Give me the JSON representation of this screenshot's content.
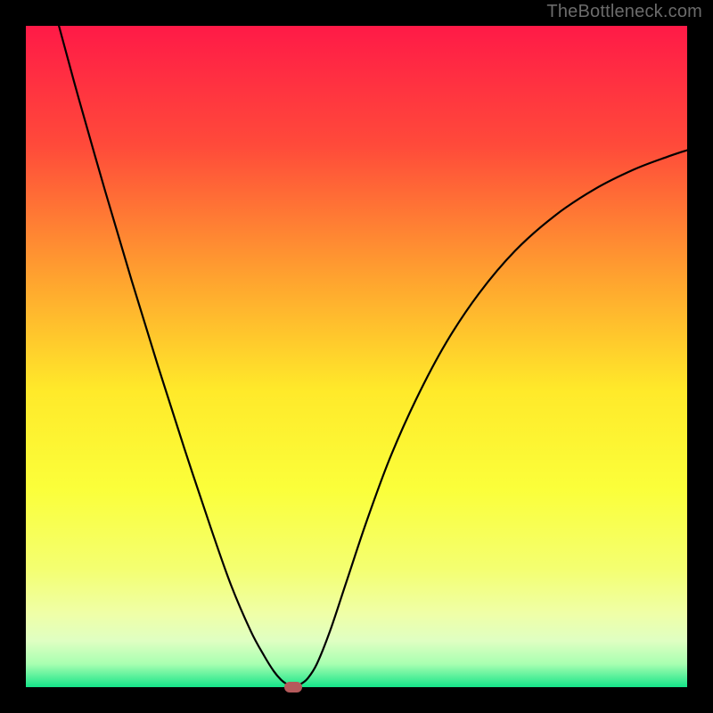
{
  "attribution": "TheBottleneck.com",
  "chart_data": {
    "type": "line",
    "title": "",
    "xlabel": "",
    "ylabel": "",
    "xlim": [
      0,
      100
    ],
    "ylim": [
      0,
      100
    ],
    "background_gradient": {
      "stops": [
        {
          "offset": 0.0,
          "color": "#ff1a47"
        },
        {
          "offset": 0.18,
          "color": "#ff4a3a"
        },
        {
          "offset": 0.38,
          "color": "#ffa22f"
        },
        {
          "offset": 0.55,
          "color": "#ffe92a"
        },
        {
          "offset": 0.7,
          "color": "#fbff3a"
        },
        {
          "offset": 0.82,
          "color": "#f4ff70"
        },
        {
          "offset": 0.89,
          "color": "#efffa8"
        },
        {
          "offset": 0.93,
          "color": "#dfffc2"
        },
        {
          "offset": 0.965,
          "color": "#a8ffb1"
        },
        {
          "offset": 0.985,
          "color": "#55f09a"
        },
        {
          "offset": 1.0,
          "color": "#14e589"
        }
      ]
    },
    "series": [
      {
        "name": "bottleneck-curve",
        "color": "#000000",
        "stroke_width": 2.2,
        "points": [
          {
            "x": 5.0,
            "y": 100.0
          },
          {
            "x": 8.0,
            "y": 89.0
          },
          {
            "x": 12.0,
            "y": 75.0
          },
          {
            "x": 16.0,
            "y": 61.5
          },
          {
            "x": 20.0,
            "y": 48.5
          },
          {
            "x": 24.0,
            "y": 36.0
          },
          {
            "x": 28.0,
            "y": 24.0
          },
          {
            "x": 31.0,
            "y": 15.5
          },
          {
            "x": 34.0,
            "y": 8.5
          },
          {
            "x": 36.0,
            "y": 4.8
          },
          {
            "x": 37.5,
            "y": 2.4
          },
          {
            "x": 38.6,
            "y": 1.1
          },
          {
            "x": 39.4,
            "y": 0.5
          },
          {
            "x": 40.0,
            "y": 0.3
          },
          {
            "x": 40.8,
            "y": 0.3
          },
          {
            "x": 41.6,
            "y": 0.5
          },
          {
            "x": 42.6,
            "y": 1.3
          },
          {
            "x": 44.0,
            "y": 3.5
          },
          {
            "x": 46.0,
            "y": 8.5
          },
          {
            "x": 48.5,
            "y": 16.0
          },
          {
            "x": 51.5,
            "y": 25.0
          },
          {
            "x": 55.0,
            "y": 34.5
          },
          {
            "x": 59.0,
            "y": 43.5
          },
          {
            "x": 63.5,
            "y": 52.0
          },
          {
            "x": 68.5,
            "y": 59.5
          },
          {
            "x": 74.0,
            "y": 66.0
          },
          {
            "x": 80.0,
            "y": 71.3
          },
          {
            "x": 86.0,
            "y": 75.3
          },
          {
            "x": 92.0,
            "y": 78.3
          },
          {
            "x": 97.0,
            "y": 80.2
          },
          {
            "x": 100.0,
            "y": 81.2
          }
        ]
      }
    ],
    "marker": {
      "name": "optimal-point",
      "x": 40.4,
      "y": 0.0,
      "color": "#b55a5b"
    }
  }
}
